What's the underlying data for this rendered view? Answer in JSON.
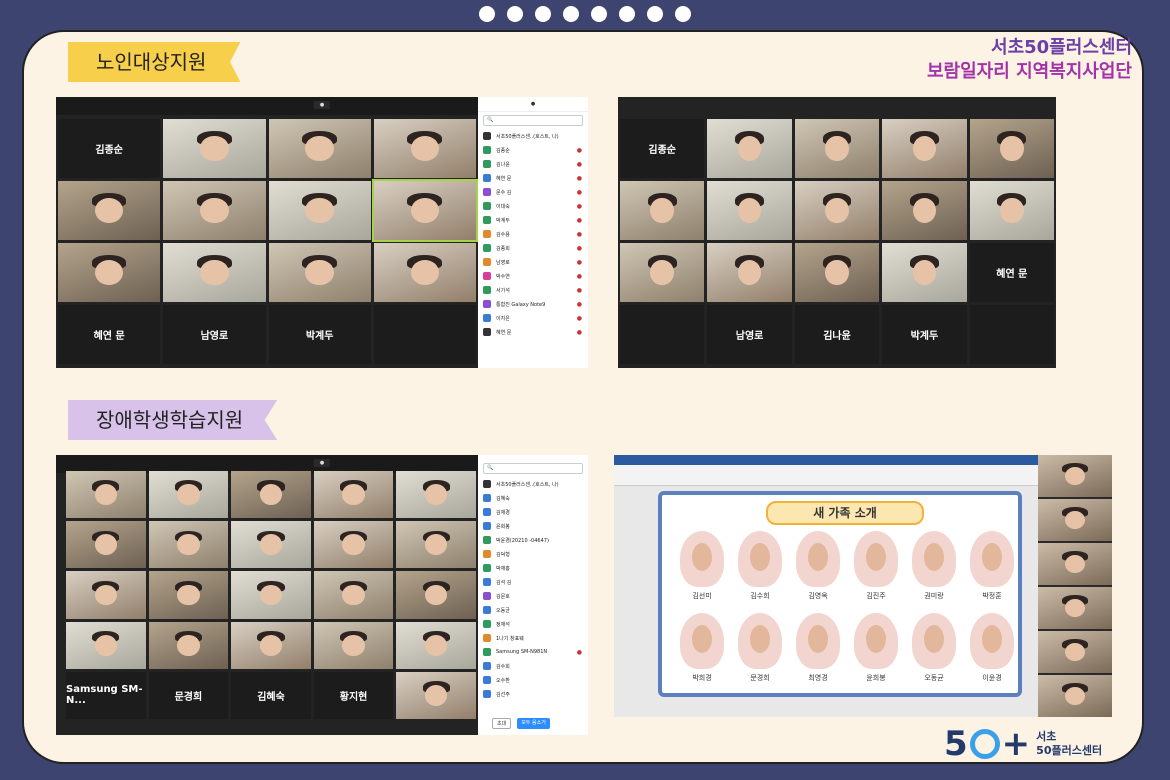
{
  "org": {
    "line1": "서초50플러스센터",
    "line2": "보람일자리 지역복지사업단"
  },
  "sections": {
    "elderly": "노인대상지원",
    "disabled": "장애학생학습지원"
  },
  "panel1": {
    "names": [
      "김종순",
      "혜연 문",
      "남영로",
      "박계두"
    ],
    "participants": [
      "서초50플러스센..(호스트, 나)",
      "김종순",
      "김나윤",
      "혜연 문",
      "문수 김",
      "이대숙",
      "박계두",
      "김수용",
      "김종희",
      "남영로",
      "박수연",
      "서기석",
      "통합진 Galaxy Note9",
      "이지은",
      "혜연 문"
    ]
  },
  "panel2": {
    "names": [
      "김종순",
      "혜연 문",
      "남영로",
      "김나윤",
      "박계두"
    ]
  },
  "panel3": {
    "names": [
      "Samsung SM-N...",
      "문경희",
      "김혜숙",
      "황지현"
    ],
    "participants": [
      "서초50플러스센..(호스트, 나)",
      "김혜숙",
      "김재경",
      "윤희봉",
      "박윤경(20210 -04647)",
      "김덕형",
      "박재홍",
      "김석 김",
      "김문호",
      "오동균",
      "정재석",
      "1나기 창표웨",
      "Samsung SM-N981N",
      "김수희",
      "오수환",
      "김선주"
    ],
    "buttons": {
      "invite": "초대",
      "mute_all": "모두 음소거"
    }
  },
  "slide": {
    "title": "새 가족 소개",
    "people": [
      "김선미",
      "김수희",
      "김영옥",
      "김진주",
      "권미랑",
      "박정훈",
      "박희경",
      "문경희",
      "최영경",
      "윤희봉",
      "오동균",
      "이윤경"
    ]
  },
  "logo": {
    "num": "5",
    "line1": "서초",
    "line2": "50플러스센터"
  }
}
